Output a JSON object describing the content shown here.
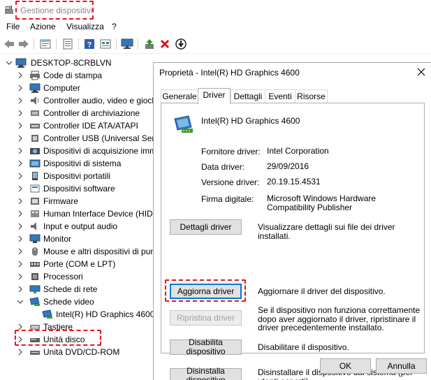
{
  "window": {
    "title": "Gestione dispositivi"
  },
  "menu": [
    "File",
    "Azione",
    "Visualizza",
    "?"
  ],
  "toolbar": {
    "icons": [
      "back-arrow-icon",
      "forward-arrow-icon",
      "properties-icon",
      "help-icon",
      "view-icon",
      "monitor-icon",
      "update-driver-icon",
      "uninstall-icon",
      "download-icon"
    ]
  },
  "tree": {
    "root": "DESKTOP-8CRBLVN",
    "items": [
      {
        "label": "Code di stampa",
        "icon": "print-queue-icon"
      },
      {
        "label": "Computer",
        "icon": "computer-icon"
      },
      {
        "label": "Controller audio, video e giochi",
        "icon": "audio-icon"
      },
      {
        "label": "Controller di archiviazione",
        "icon": "storage-controller-icon"
      },
      {
        "label": "Controller IDE ATA/ATAPI",
        "icon": "ide-controller-icon"
      },
      {
        "label": "Controller USB (Universal Serial Bus)",
        "icon": "usb-icon"
      },
      {
        "label": "Dispositivi di acquisizione immagini",
        "icon": "camera-icon"
      },
      {
        "label": "Dispositivi di sistema",
        "icon": "system-device-icon"
      },
      {
        "label": "Dispositivi portatili",
        "icon": "portable-device-icon"
      },
      {
        "label": "Dispositivi software",
        "icon": "software-device-icon"
      },
      {
        "label": "Firmware",
        "icon": "firmware-icon"
      },
      {
        "label": "Human Interface Device (HID)",
        "icon": "hid-icon"
      },
      {
        "label": "Input e output audio",
        "icon": "speaker-icon"
      },
      {
        "label": "Monitor",
        "icon": "monitor-icon"
      },
      {
        "label": "Mouse e altri dispositivi di puntamento",
        "icon": "mouse-icon"
      },
      {
        "label": "Porte (COM e LPT)",
        "icon": "port-icon"
      },
      {
        "label": "Processori",
        "icon": "processor-icon"
      },
      {
        "label": "Schede di rete",
        "icon": "network-adapter-icon"
      },
      {
        "label": "Schede video",
        "icon": "display-adapter-icon",
        "expanded": true
      },
      {
        "label": "Intel(R) HD Graphics 4600",
        "icon": "display-adapter-icon",
        "child": true
      },
      {
        "label": "Tastiere",
        "icon": "keyboard-icon"
      },
      {
        "label": "Unità disco",
        "icon": "disk-drive-icon"
      },
      {
        "label": "Unità DVD/CD-ROM",
        "icon": "dvd-icon"
      }
    ]
  },
  "dialog": {
    "title": "Proprietà - Intel(R) HD Graphics 4600",
    "tabs": [
      "Generale",
      "Driver",
      "Dettagli",
      "Eventi",
      "Risorse"
    ],
    "active_tab": "Driver",
    "device_name": "Intel(R) HD Graphics 4600",
    "properties": [
      {
        "label": "Fornitore driver:",
        "value": "Intel Corporation"
      },
      {
        "label": "Data driver:",
        "value": "29/09/2016"
      },
      {
        "label": "Versione driver:",
        "value": "20.19.15.4531"
      },
      {
        "label": "Firma digitale:",
        "value": "Microsoft Windows Hardware Compatibility Publisher"
      }
    ],
    "actions": [
      {
        "button": "Dettagli driver",
        "description": "Visualizzare dettagli sui file dei driver installati."
      },
      {
        "button": "Aggiorna driver",
        "description": "Aggiornare il driver del dispositivo."
      },
      {
        "button": "Ripristina driver",
        "description": "Se il dispositivo non funziona correttamente dopo aver aggiornato il driver, ripristinare il driver precedentemente installato.",
        "disabled": true
      },
      {
        "button": "Disabilita dispositivo",
        "description": "Disabilitare il dispositivo."
      },
      {
        "button": "Disinstalla dispositivo",
        "description": "Disinstallare il dispositivo dal sistema (per utenti esperti)."
      }
    ],
    "ok": "OK",
    "cancel": "Annulla"
  },
  "colors": {
    "highlight": "#e8141e",
    "focus": "#0078d7",
    "icon_blue": "#2f78c4",
    "icon_green": "#3a9a3a"
  }
}
